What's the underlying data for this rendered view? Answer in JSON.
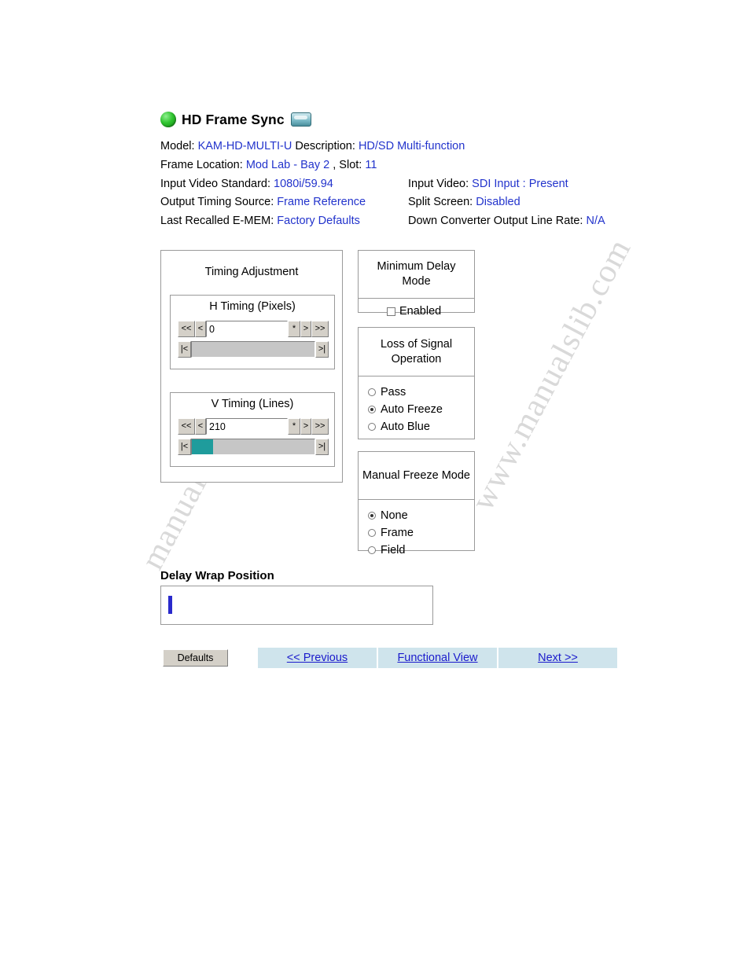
{
  "header": {
    "title": "HD Frame Sync",
    "led_color": "#2fc42f",
    "model_label": "Model:",
    "model_value": "KAM-HD-MULTI-U",
    "description_label": "Description:",
    "description_value": "HD/SD Multi-function",
    "frame_location_label": "Frame Location:",
    "frame_location_value": "Mod Lab - Bay 2",
    "slot_label": ", Slot:",
    "slot_value": "11",
    "input_video_standard_label": "Input Video Standard:",
    "input_video_standard_value": "1080i/59.94",
    "input_video_label": "Input Video:",
    "input_video_value": "SDI Input : Present",
    "output_timing_source_label": "Output Timing Source:",
    "output_timing_source_value": "Frame Reference",
    "split_screen_label": "Split Screen:",
    "split_screen_value": "Disabled",
    "last_recalled_label": "Last Recalled E-MEM:",
    "last_recalled_value": "Factory Defaults",
    "down_converter_label": "Down Converter Output Line Rate:",
    "down_converter_value": "N/A",
    "link_color": "#2233cc"
  },
  "timing_adjustment": {
    "title": "Timing Adjustment",
    "h_timing": {
      "title": "H Timing (Pixels)",
      "value": "0",
      "buttons": {
        "fast_down": "<<",
        "down": "<",
        "star": "*",
        "up": ">",
        "fast_up": ">>",
        "home": "|<",
        "end": ">|"
      },
      "slider_percent": 0
    },
    "v_timing": {
      "title": "V Timing (Lines)",
      "value": "210",
      "buttons": {
        "fast_down": "<<",
        "down": "<",
        "star": "*",
        "up": ">",
        "fast_up": ">>",
        "home": "|<",
        "end": ">|"
      },
      "slider_percent": 17
    }
  },
  "minimum_delay": {
    "title": "Minimum Delay Mode",
    "option_label": "Enabled",
    "checked": false
  },
  "loss_of_signal": {
    "title": "Loss of Signal Operation",
    "options": [
      {
        "label": "Pass",
        "selected": false
      },
      {
        "label": "Auto Freeze",
        "selected": true
      },
      {
        "label": "Auto Blue",
        "selected": false
      }
    ]
  },
  "manual_freeze": {
    "title": "Manual Freeze Mode",
    "options": [
      {
        "label": "None",
        "selected": true
      },
      {
        "label": "Frame",
        "selected": false
      },
      {
        "label": "Field",
        "selected": false
      }
    ]
  },
  "delay_wrap": {
    "label": "Delay Wrap Position",
    "marker_color": "#2a2acc"
  },
  "footer": {
    "defaults_label": "Defaults",
    "previous_label": "<< Previous",
    "functional_view_label": "Functional View",
    "next_label": "Next >>"
  },
  "watermark": {
    "line1": "manualslib.com",
    "line2": "www.manualslib.com"
  }
}
